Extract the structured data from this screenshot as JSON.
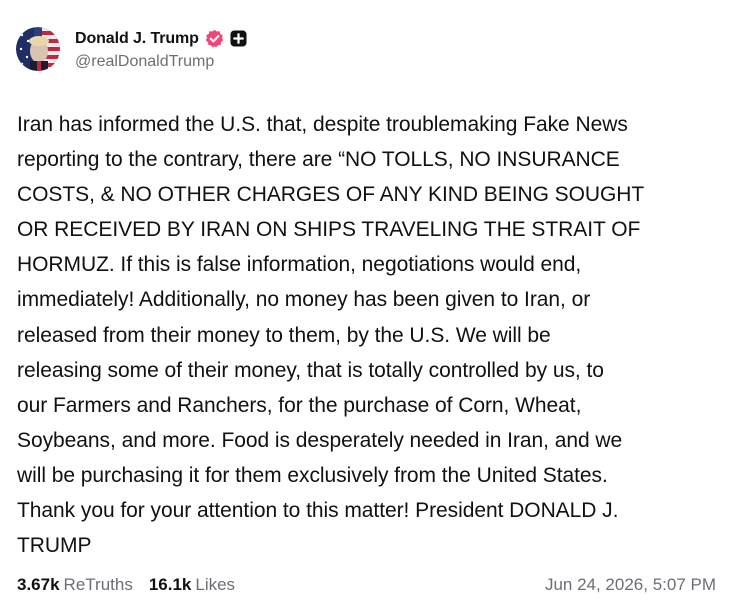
{
  "author": {
    "display_name": "Donald J. Trump",
    "handle": "@realDonaldTrump",
    "verified_icon": "verified-badge-icon",
    "extra_icon": "plus-square-icon",
    "colors": {
      "verified_badge": "#f0477a",
      "plus_badge": "#111111"
    }
  },
  "post": {
    "text": "Iran has informed the U.S. that, despite troublemaking Fake News\nreporting to the contrary, there are “NO TOLLS, NO INSURANCE\nCOSTS, & NO OTHER CHARGES OF ANY KIND BEING SOUGHT\nOR RECEIVED BY IRAN ON SHIPS TRAVELING THE STRAIT OF\nHORMUZ. If this is false information, negotiations would end,\nimmediately! Additionally, no money has been given to Iran, or\nreleased from their money to them, by the U.S. We will be\nreleasing some of their money, that is totally controlled by us, to\nour Farmers and Ranchers, for the purchase of Corn, Wheat,\nSoybeans, and more. Food is desperately needed in Iran, and we\nwill be purchasing it for them exclusively from the United States.\nThank you for your attention to this matter! President DONALD J.\nTRUMP"
  },
  "stats": {
    "retruths_count": "3.67k",
    "retruths_label": "ReTruths",
    "likes_count": "16.1k",
    "likes_label": "Likes"
  },
  "timestamp": "Jun 24, 2026, 5:07 PM"
}
